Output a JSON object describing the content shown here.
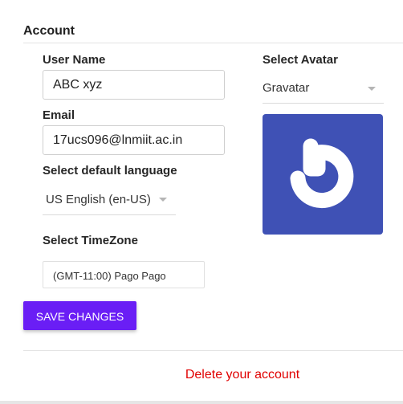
{
  "account": {
    "title": "Account"
  },
  "form": {
    "username_label": "User Name",
    "username_value": "ABC xyz",
    "email_label": "Email",
    "email_value": "17ucs096@lnmiit.ac.in",
    "language_label": "Select default language",
    "language_value": "US English (en-US)",
    "timezone_label": "Select TimeZone",
    "timezone_value": "(GMT-11:00) Pago Pago"
  },
  "avatar": {
    "label": "Select Avatar",
    "value": "Gravatar",
    "image_icon": "gravatar-logo-icon",
    "bg_color": "#3f51b5"
  },
  "actions": {
    "save_label": "SAVE CHANGES",
    "save_color": "#6a1ef5",
    "delete_label": "Delete your account",
    "delete_color": "#e00000"
  }
}
